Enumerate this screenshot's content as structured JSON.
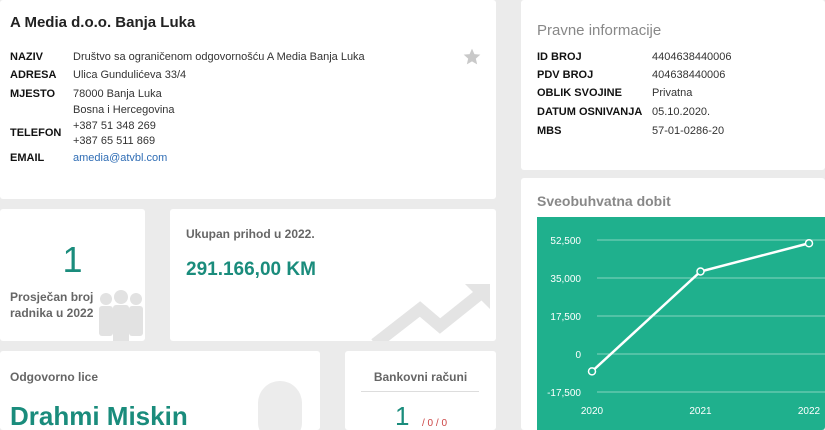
{
  "company": {
    "name": "A Media d.o.o. Banja Luka",
    "rows": [
      {
        "label": "NAZIV",
        "value": "Društvo sa ograničenom odgovornošću A Media Banja Luka"
      },
      {
        "label": "ADRESA",
        "value": "Ulica Gundulićeva 33/4"
      },
      {
        "label": "MJESTO",
        "value": "78000 Banja Luka"
      },
      {
        "label": "",
        "value": "Bosna i Hercegovina"
      },
      {
        "label": "TELEFON",
        "value": "+387 51 348 269"
      },
      {
        "label": "",
        "value": "+387 65 511 869"
      },
      {
        "label": "EMAIL",
        "value": "amedia@atvbl.com"
      }
    ]
  },
  "legal": {
    "title": "Pravne informacije",
    "rows": [
      {
        "label": "ID BROJ",
        "value": "4404638440006"
      },
      {
        "label": "PDV BROJ",
        "value": "404638440006"
      },
      {
        "label": "OBLIK SVOJINE",
        "value": "Privatna"
      },
      {
        "label": "DATUM OSNIVANJA",
        "value": "05.10.2020."
      },
      {
        "label": "MBS",
        "value": "57-01-0286-20"
      }
    ]
  },
  "workers": {
    "value": "1",
    "caption": "Prosječan broj radnika u 2022"
  },
  "income": {
    "caption": "Ukupan prihod u 2022.",
    "amount": "291.166,00 KM"
  },
  "person": {
    "caption": "Odgovorno lice",
    "name": "Drahmi Miskin"
  },
  "bank": {
    "caption": "Bankovni računi",
    "count": "1",
    "sub": "/ 0 / 0"
  },
  "profit": {
    "title": "Sveobuhvatna dobit"
  },
  "colors": {
    "accent": "#1a8c7c",
    "chart_bg": "#1fb08d"
  },
  "icons": {
    "favorite": "star-icon",
    "workers": "people-icon",
    "income": "growth-arrow-icon",
    "person": "person-silhouette-icon"
  },
  "chart_data": {
    "type": "line",
    "title": "Sveobuhvatna dobit",
    "categories": [
      "2020",
      "2021",
      "2022"
    ],
    "values": [
      -8000,
      38000,
      51000
    ],
    "yticks": [
      "52,500",
      "35,000",
      "17,500",
      "0",
      "-17,500"
    ],
    "ylim": [
      -17500,
      52500
    ],
    "grid": true
  }
}
